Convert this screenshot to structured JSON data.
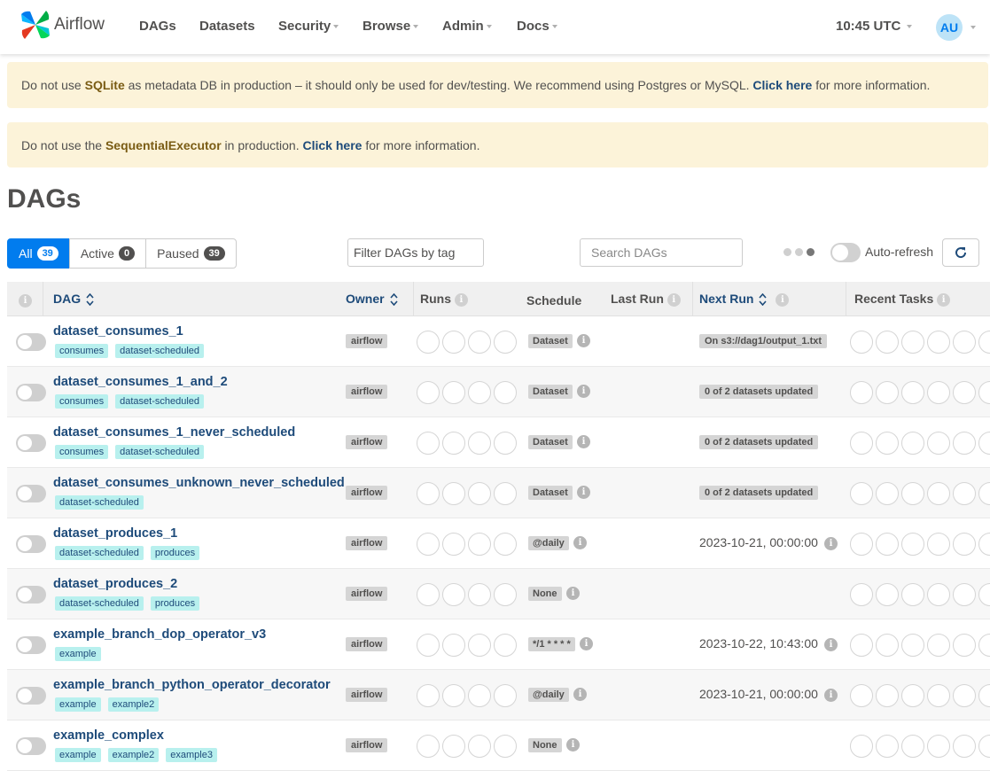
{
  "brand": "Airflow",
  "nav": [
    "DAGs",
    "Datasets",
    "Security",
    "Browse",
    "Admin",
    "Docs"
  ],
  "time": "10:45 UTC",
  "user_initials": "AU",
  "alerts": {
    "sqlite": {
      "pre": "Do not use ",
      "bold": "SQLite",
      "mid": " as metadata DB in production – it should only be used for dev/testing. We recommend using Postgres or MySQL. ",
      "link": "Click here",
      "post": " for more information."
    },
    "executor": {
      "pre": "Do not use the ",
      "bold": "SequentialExecutor",
      "mid": " in production. ",
      "link": "Click here",
      "post": " for more information."
    }
  },
  "page_title": "DAGs",
  "filters": {
    "all": {
      "label": "All",
      "count": "39"
    },
    "active": {
      "label": "Active",
      "count": "0"
    },
    "paused": {
      "label": "Paused",
      "count": "39"
    }
  },
  "tag_filter_placeholder": "Filter DAGs by tag",
  "search_placeholder": "Search DAGs",
  "auto_refresh_label": "Auto-refresh",
  "columns": {
    "dag": "DAG",
    "owner": "Owner",
    "runs": "Runs",
    "schedule": "Schedule",
    "last_run": "Last Run",
    "next_run": "Next Run",
    "recent_tasks": "Recent Tasks"
  },
  "info_glyph": "i",
  "rows": [
    {
      "name": "dataset_consumes_1",
      "tags": [
        "consumes",
        "dataset-scheduled"
      ],
      "owner": "airflow",
      "schedule": "Dataset",
      "next_run": "On s3://dag1/output_1.txt",
      "next_run_kind": "badge"
    },
    {
      "name": "dataset_consumes_1_and_2",
      "tags": [
        "consumes",
        "dataset-scheduled"
      ],
      "owner": "airflow",
      "schedule": "Dataset",
      "next_run": "0 of 2 datasets updated",
      "next_run_kind": "badge"
    },
    {
      "name": "dataset_consumes_1_never_scheduled",
      "tags": [
        "consumes",
        "dataset-scheduled"
      ],
      "owner": "airflow",
      "schedule": "Dataset",
      "next_run": "0 of 2 datasets updated",
      "next_run_kind": "badge"
    },
    {
      "name": "dataset_consumes_unknown_never_scheduled",
      "tags": [
        "dataset-scheduled"
      ],
      "owner": "airflow",
      "schedule": "Dataset",
      "next_run": "0 of 2 datasets updated",
      "next_run_kind": "badge"
    },
    {
      "name": "dataset_produces_1",
      "tags": [
        "dataset-scheduled",
        "produces"
      ],
      "owner": "airflow",
      "schedule": "@daily",
      "next_run": "2023-10-21, 00:00:00",
      "next_run_kind": "text"
    },
    {
      "name": "dataset_produces_2",
      "tags": [
        "dataset-scheduled",
        "produces"
      ],
      "owner": "airflow",
      "schedule": "None",
      "next_run": "",
      "next_run_kind": "none"
    },
    {
      "name": "example_branch_dop_operator_v3",
      "tags": [
        "example"
      ],
      "owner": "airflow",
      "schedule": "*/1 * * * *",
      "next_run": "2023-10-22, 10:43:00",
      "next_run_kind": "text"
    },
    {
      "name": "example_branch_python_operator_decorator",
      "tags": [
        "example",
        "example2"
      ],
      "owner": "airflow",
      "schedule": "@daily",
      "next_run": "2023-10-21, 00:00:00",
      "next_run_kind": "text"
    },
    {
      "name": "example_complex",
      "tags": [
        "example",
        "example2",
        "example3"
      ],
      "owner": "airflow",
      "schedule": "None",
      "next_run": "",
      "next_run_kind": "none"
    }
  ],
  "colors": {
    "primary": "#017cee",
    "link": "#1e4b7a",
    "tag_bg": "#b8f0ee",
    "alert_bg": "#fcf3d9"
  }
}
